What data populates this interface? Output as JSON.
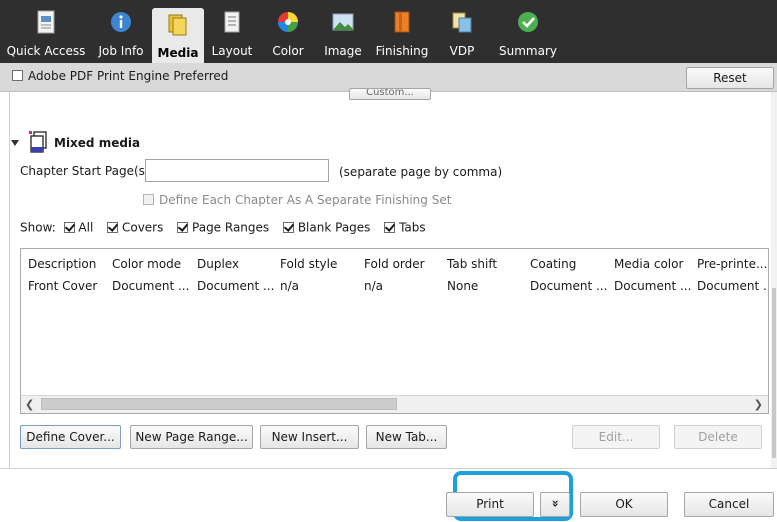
{
  "tabs": [
    {
      "label": "Quick Access",
      "icon": "quick-access-icon"
    },
    {
      "label": "Job Info",
      "icon": "job-info-icon"
    },
    {
      "label": "Media",
      "icon": "media-icon",
      "active": true
    },
    {
      "label": "Layout",
      "icon": "layout-icon"
    },
    {
      "label": "Color",
      "icon": "color-icon"
    },
    {
      "label": "Image",
      "icon": "image-icon"
    },
    {
      "label": "Finishing",
      "icon": "finishing-icon"
    },
    {
      "label": "VDP",
      "icon": "vdp-icon"
    },
    {
      "label": "Summary",
      "icon": "summary-icon"
    }
  ],
  "subbar": {
    "adobe_label": "Adobe PDF Print Engine Preferred",
    "adobe_checked": false,
    "reset_label": "Reset"
  },
  "custom_button_label": "Custom...",
  "mixed_media": {
    "title": "Mixed media",
    "chapter_label": "Chapter Start Page(s):",
    "chapter_value": "",
    "chapter_hint": "(separate page by comma)",
    "define_each_label": "Define Each Chapter As A Separate Finishing Set",
    "define_each_checked": false
  },
  "show": {
    "label": "Show:",
    "options": [
      {
        "label": "All",
        "checked": true
      },
      {
        "label": "Covers",
        "checked": true
      },
      {
        "label": "Page Ranges",
        "checked": true
      },
      {
        "label": "Blank Pages",
        "checked": true
      },
      {
        "label": "Tabs",
        "checked": true
      }
    ]
  },
  "table": {
    "columns": [
      "Description",
      "Color mode",
      "Duplex",
      "Fold style",
      "Fold order",
      "Tab shift",
      "Coating",
      "Media color",
      "Pre-printe..."
    ],
    "rows": [
      [
        "Front Cover",
        "Document ...",
        "Document ...",
        "n/a",
        "n/a",
        "None",
        "Document ...",
        "Document ...",
        "Document ..."
      ]
    ]
  },
  "actions": {
    "define_cover": "Define Cover...",
    "new_page_range": "New Page Range...",
    "new_insert": "New Insert...",
    "new_tab": "New Tab...",
    "edit": "Edit...",
    "delete": "Delete"
  },
  "footer": {
    "print": "Print",
    "print_menu_glyph": "»",
    "ok": "OK",
    "cancel": "Cancel",
    "highlight_color": "#1ea0dc"
  }
}
